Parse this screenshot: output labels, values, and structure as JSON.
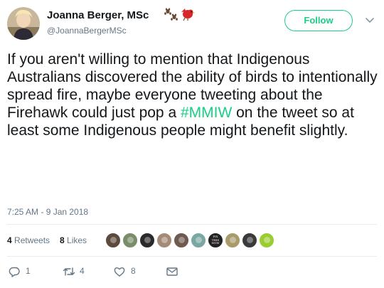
{
  "author": {
    "display_name": "Joanna Berger, MSc",
    "handle": "@JoannaBergerMSc",
    "name_emojis": [
      "paw-prints-icon",
      "red-bird-icon"
    ]
  },
  "follow_button": {
    "label": "Follow"
  },
  "tweet": {
    "text_before": "If you aren't willing to mention that Indigenous Australians discovered the ability of birds to intentionally spread fire, maybe everyone tweeting about the Firehawk could just pop a ",
    "hashtag": "#MMIW",
    "text_after": " on the tweet so at least some Indigenous people might benefit slightly.",
    "timestamp": "7:25 AM - 9 Jan 2018"
  },
  "stats": {
    "retweets_count": "4",
    "retweets_label": "Retweets",
    "likes_count": "8",
    "likes_label": "Likes"
  },
  "likers": [
    {
      "name": "liker-avatar-1",
      "color": "#5c4a3e"
    },
    {
      "name": "liker-avatar-2",
      "color": "#7b8c6a"
    },
    {
      "name": "liker-avatar-3",
      "color": "#2a2a2a"
    },
    {
      "name": "liker-avatar-4",
      "color": "#a58a78"
    },
    {
      "name": "liker-avatar-5",
      "color": "#6e5a4f"
    },
    {
      "name": "liker-avatar-6",
      "color": "#7aa7a2"
    },
    {
      "name": "liker-avatar-7",
      "color": "#222222"
    },
    {
      "name": "liker-avatar-8",
      "color": "#a89a6a"
    },
    {
      "name": "liker-avatar-9",
      "color": "#3a3a3a"
    },
    {
      "name": "liker-avatar-10",
      "color": "#9acd32"
    }
  ],
  "liker_badge_text": [
    "FIX",
    "THIS",
    "NOW"
  ],
  "actions": {
    "reply_count": "1",
    "retweet_count": "4",
    "like_count": "8"
  },
  "colors": {
    "accent_green": "#19cf86",
    "text_primary": "#14171a",
    "text_secondary": "#657786",
    "divider": "#e6ecf0"
  }
}
